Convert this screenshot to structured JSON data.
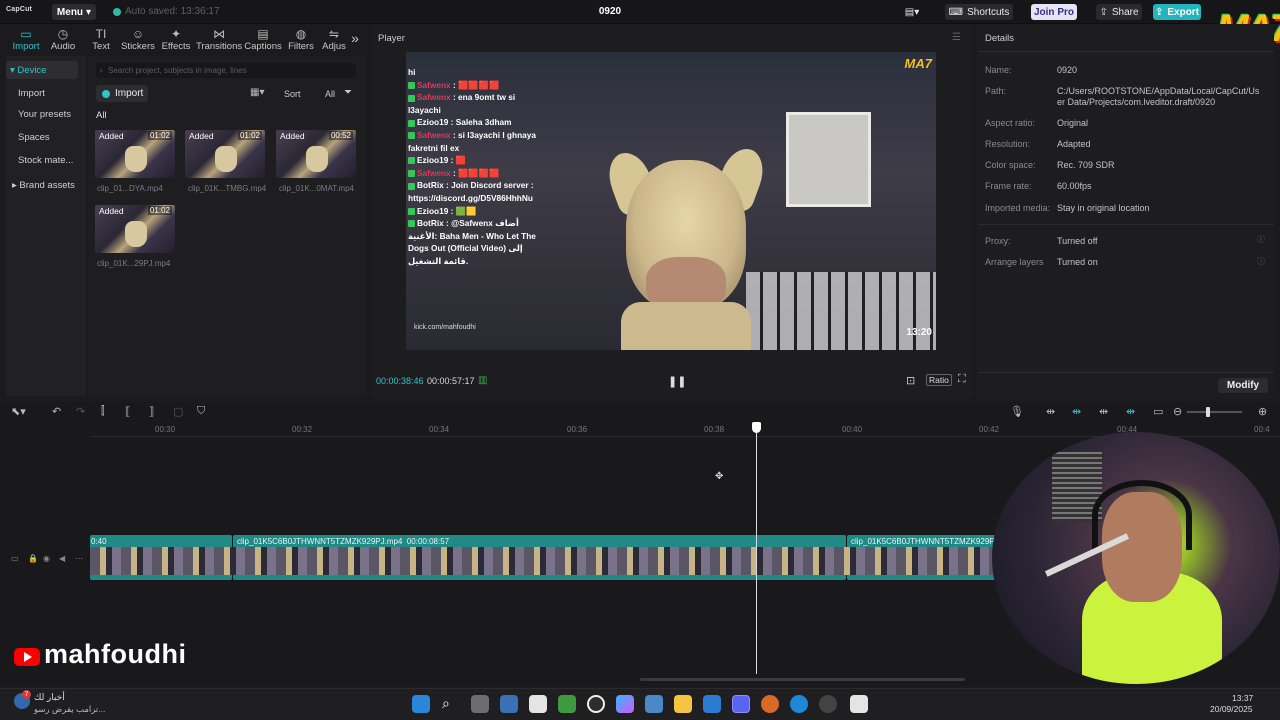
{
  "app": {
    "logo": "CapCut",
    "menu_label": "Menu",
    "autosave": "Auto saved: 13:36:17",
    "project_title": "0920",
    "shortcuts": "Shortcuts",
    "join_pro": "Join Pro",
    "share": "Share",
    "export": "Export",
    "overlay_logo": "MA7"
  },
  "tools": [
    {
      "label": "Import",
      "icon": "import-icon",
      "glyph": "▭"
    },
    {
      "label": "Audio",
      "icon": "audio-icon",
      "glyph": "◷"
    },
    {
      "label": "Text",
      "icon": "text-icon",
      "glyph": "TI"
    },
    {
      "label": "Stickers",
      "icon": "sticker-icon",
      "glyph": "☺"
    },
    {
      "label": "Effects",
      "icon": "effects-icon",
      "glyph": "✦"
    },
    {
      "label": "Transitions",
      "icon": "transition-icon",
      "glyph": "⋈"
    },
    {
      "label": "Captions",
      "icon": "captions-icon",
      "glyph": "▤"
    },
    {
      "label": "Filters",
      "icon": "filter-icon",
      "glyph": "◍"
    },
    {
      "label": "Adjus",
      "icon": "adjust-icon",
      "glyph": "⇋"
    }
  ],
  "sidebar": {
    "items": [
      {
        "label": "Device",
        "selected": true,
        "prefix": "▾"
      },
      {
        "label": "Import",
        "selected": false,
        "prefix": ""
      },
      {
        "label": "Your presets",
        "selected": false,
        "prefix": ""
      },
      {
        "label": "Spaces",
        "selected": false,
        "prefix": ""
      },
      {
        "label": "Stock mate...",
        "selected": false,
        "prefix": ""
      },
      {
        "label": "Brand assets",
        "selected": false,
        "prefix": "▸"
      }
    ]
  },
  "media": {
    "search_placeholder": "Search project, subjects in image, lines",
    "import_label": "Import",
    "sort_label": "Sort",
    "filter_label": "All",
    "section_label": "All",
    "clips": [
      {
        "badge": "Added",
        "duration": "01:02",
        "name": "clip_01...DYA.mp4"
      },
      {
        "badge": "Added",
        "duration": "01:02",
        "name": "clip_01K...TMBG.mp4"
      },
      {
        "badge": "Added",
        "duration": "00:52",
        "name": "clip_01K...0MAT.mp4"
      },
      {
        "badge": "Added",
        "duration": "01:02",
        "name": "clip_01K...29PJ.mp4"
      }
    ]
  },
  "player": {
    "title": "Player",
    "current_time": "00:00:38:46",
    "total_time": "00:00:57:17",
    "ratio_label": "Ratio",
    "video_overlay": {
      "top_line": "hi",
      "chat": [
        {
          "user": "Safwenx",
          "text": " : 🟥🟥🟥🟥",
          "color": "red"
        },
        {
          "user": "Safwenx",
          "text": " : ena 9omt tw si l3ayachi",
          "color": "red"
        },
        {
          "user": "Ezioo19",
          "text": " : Saleha 3dham",
          "color": "white"
        },
        {
          "user": "Safwenx",
          "text": " : si l3ayachi l ghnaya fakretni fil ex",
          "color": "red"
        },
        {
          "user": "Ezioo19",
          "text": " : 🟥",
          "color": "white"
        },
        {
          "user": "Safwenx",
          "text": " : 🟥🟥🟥🟥",
          "color": "red"
        },
        {
          "user": "BotRix",
          "text": " : Join Discord server : https://discord.gg/D5V86HhhNu",
          "color": "white"
        },
        {
          "user": "Ezioo19",
          "text": " : 🟩🟨",
          "color": "white"
        },
        {
          "user": "BotRix",
          "text": " : @Safwenx أضاف الأغنية: Baha Men - Who Let The Dogs Out (Official Video) إلى قائمة التشغيل.",
          "color": "white"
        }
      ],
      "kick": "kick.com/mahfoudhi",
      "stamp": "13:20",
      "logo": "MA7"
    }
  },
  "details": {
    "title": "Details",
    "rows": [
      {
        "label": "Name:",
        "value": "0920"
      },
      {
        "label": "Path:",
        "value": "C:/Users/ROOTSTONE/AppData/Local/CapCut/User Data/Projects/com.lveditor.draft/0920"
      },
      {
        "label": "Aspect ratio:",
        "value": "Original"
      },
      {
        "label": "Resolution:",
        "value": "Adapted"
      },
      {
        "label": "Color space:",
        "value": "Rec. 709 SDR"
      },
      {
        "label": "Frame rate:",
        "value": "60.00fps"
      },
      {
        "label": "Imported media:",
        "value": "Stay in original location"
      },
      {
        "label": "Proxy:",
        "value": "Turned off"
      },
      {
        "label": "Arrange layers",
        "value": "Turned on"
      }
    ],
    "modify_label": "Modify"
  },
  "timeline": {
    "ruler": [
      "00:30",
      "00:32",
      "00:34",
      "00:36",
      "00:38",
      "00:40",
      "00:42",
      "00:44",
      "00:4"
    ],
    "clips": [
      {
        "name": "0:40",
        "duration": ""
      },
      {
        "name": "clip_01K5C6B0JTHWNNT5TZMZK929PJ.mp4",
        "duration": "00:00:08:57"
      },
      {
        "name": "clip_01K5C6B0JTHWNNT5TZMZK929PJ.m",
        "duration": ""
      }
    ]
  },
  "overlay": {
    "channel": "mahfoudhi"
  },
  "taskbar": {
    "news_line1": "أخبار لك",
    "news_line2": "ترامب يفرض رسو...",
    "badge": "7",
    "time": "13:37",
    "date": "20/09/2025"
  },
  "colors": {
    "accent": "#2fc4cc",
    "clip": "#1f8a86",
    "export": "#22b5bd",
    "chat_red": "#e0375a"
  }
}
